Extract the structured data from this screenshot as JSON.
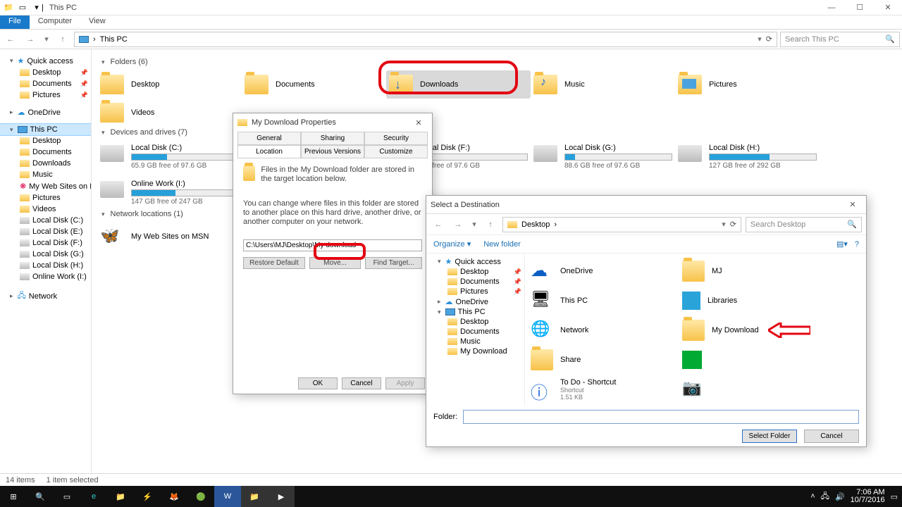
{
  "window": {
    "title": "This PC"
  },
  "ribbon": {
    "tabs": [
      "File",
      "Computer",
      "View"
    ]
  },
  "addressbar": {
    "crumb0": "This PC",
    "search_placeholder": "Search This PC"
  },
  "navpane": {
    "quick": "Quick access",
    "quick_items": [
      "Desktop",
      "Documents",
      "Pictures"
    ],
    "onedrive": "OneDrive",
    "thispc": "This PC",
    "thispc_items": [
      "Desktop",
      "Documents",
      "Downloads",
      "Music",
      "My Web Sites on M",
      "Pictures",
      "Videos",
      "Local Disk (C:)",
      "Local Disk (E:)",
      "Local Disk (F:)",
      "Local Disk (G:)",
      "Local Disk (H:)",
      "Online Work (I:)"
    ],
    "network": "Network"
  },
  "sections": {
    "folders": "Folders (6)",
    "drives": "Devices and drives (7)",
    "netloc": "Network locations (1)"
  },
  "folders": [
    "Desktop",
    "Documents",
    "Downloads",
    "Music",
    "Pictures",
    "Videos"
  ],
  "drives": [
    {
      "name": "Local Disk (C:)",
      "free": "65.9 GB free of 97.6 GB",
      "pct": 33,
      "red": false
    },
    {
      "name": "Online Work (I:)",
      "free": "147 GB free of 247 GB",
      "pct": 41,
      "red": false
    },
    {
      "name": "Local Disk (F:)",
      "free": "GB free of 97.6 GB",
      "pct": 10,
      "red": false
    },
    {
      "name": "Local Disk (G:)",
      "free": "88.6 GB free of 97.6 GB",
      "pct": 9,
      "red": false
    },
    {
      "name": "Local Disk (H:)",
      "free": "127 GB free of 292 GB",
      "pct": 56,
      "red": false
    }
  ],
  "netloc": {
    "name": "My Web Sites on MSN"
  },
  "statusbar": {
    "items": "14 items",
    "sel": "1 item selected"
  },
  "propDlg": {
    "title": "My Download Properties",
    "tabs_top": [
      "General",
      "Sharing",
      "Security"
    ],
    "tabs_bot": [
      "Location",
      "Previous Versions",
      "Customize"
    ],
    "line1": "Files in the My Download folder are stored in the target location below.",
    "line2": "You can change where files in this folder are stored to another place on this hard drive, another drive, or another computer on your network.",
    "path": "C:\\Users\\MJ\\Desktop\\My download",
    "btns": {
      "restore": "Restore Default",
      "move": "Move...",
      "find": "Find Target..."
    },
    "foot": {
      "ok": "OK",
      "cancel": "Cancel",
      "apply": "Apply"
    }
  },
  "destDlg": {
    "title": "Select a Destination",
    "crumb": "Desktop",
    "search_placeholder": "Search Desktop",
    "organize": "Organize",
    "newfolder": "New folder",
    "nav": {
      "quick": "Quick access",
      "quick_items": [
        "Desktop",
        "Documents",
        "Pictures"
      ],
      "onedrive": "OneDrive",
      "thispc": "This PC",
      "thispc_items": [
        "Desktop",
        "Documents",
        "Music",
        "My Download"
      ]
    },
    "tiles": [
      {
        "name": "OneDrive"
      },
      {
        "name": "MJ"
      },
      {
        "name": "This PC"
      },
      {
        "name": "Libraries"
      },
      {
        "name": "Network"
      },
      {
        "name": "My Download"
      },
      {
        "name": "Share"
      },
      {
        "name": ""
      },
      {
        "name": "To Do - Shortcut",
        "sub": "Shortcut",
        "sub2": "1.51 KB"
      },
      {
        "name": ""
      }
    ],
    "folder_label": "Folder:",
    "folder_value": "",
    "btns": {
      "select": "Select Folder",
      "cancel": "Cancel"
    }
  },
  "taskbar": {
    "time": "7:06 AM",
    "date": "10/7/2016"
  }
}
